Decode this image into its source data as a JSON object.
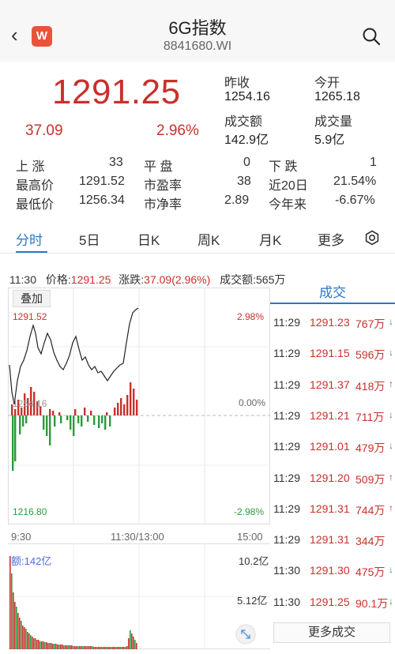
{
  "header": {
    "title": "6G指数",
    "code": "8841680.WI",
    "logo_letter": "W"
  },
  "quote": {
    "price": "1291.25",
    "change": "37.09",
    "change_pct": "2.96%",
    "prev_close_label": "昨收",
    "prev_close": "1254.16",
    "open_label": "今开",
    "open": "1265.18",
    "turnover_label": "成交额",
    "turnover": "142.9亿",
    "volume_label": "成交量",
    "volume": "5.9亿"
  },
  "stats": [
    {
      "l1": "上 涨",
      "v1": "33",
      "l2": "平 盘",
      "v2": "0",
      "l3": "下 跌",
      "v3": "1"
    },
    {
      "l1": "最高价",
      "v1": "1291.52",
      "l2": "市盈率",
      "v2": "38",
      "l3": "近20日",
      "v3": "21.54%"
    },
    {
      "l1": "最低价",
      "v1": "1256.34",
      "l2": "市净率",
      "v2": "2.89",
      "l3": "今年来",
      "v3": "-6.67%"
    }
  ],
  "tabs": [
    "分时",
    "5日",
    "日K",
    "周K",
    "月K",
    "更多"
  ],
  "info": {
    "time": "11:30",
    "price_label": "价格:",
    "price": "1291.25",
    "chg_label": "涨跌:",
    "chg": "37.09(2.96%)",
    "amt_label": "成交额:",
    "amt": "565万"
  },
  "chart": {
    "overlay_label": "叠加",
    "max_price": "1291.52",
    "min_price": "1216.80",
    "mid_price": "1254.16",
    "max_pct": "2.98%",
    "zero_pct": "0.00%",
    "min_pct": "-2.98%",
    "time_start": "9:30",
    "time_mid": "11:30/13:00",
    "time_end": "15:00",
    "vol_label": "额:142亿",
    "vol_max": "10.2亿",
    "vol_mid": "5.12亿"
  },
  "trades": {
    "header": "成交",
    "more": "更多成交",
    "rows": [
      {
        "time": "11:29",
        "price": "1291.23",
        "vol": "767万",
        "dir": "down"
      },
      {
        "time": "11:29",
        "price": "1291.15",
        "vol": "596万",
        "dir": "down"
      },
      {
        "time": "11:29",
        "price": "1291.37",
        "vol": "418万",
        "dir": "up"
      },
      {
        "time": "11:29",
        "price": "1291.21",
        "vol": "711万",
        "dir": "down"
      },
      {
        "time": "11:29",
        "price": "1291.01",
        "vol": "479万",
        "dir": "down"
      },
      {
        "time": "11:29",
        "price": "1291.20",
        "vol": "509万",
        "dir": "up"
      },
      {
        "time": "11:29",
        "price": "1291.31",
        "vol": "744万",
        "dir": "up"
      },
      {
        "time": "11:29",
        "price": "1291.31",
        "vol": "344万",
        "dir": ""
      },
      {
        "time": "11:30",
        "price": "1291.30",
        "vol": "475万",
        "dir": "down"
      },
      {
        "time": "11:30",
        "price": "1291.25",
        "vol": "90.1万",
        "dir": "down"
      }
    ]
  },
  "colors": {
    "up": "#c8312c",
    "down": "#2e9a3e",
    "accent": "#2b78c5"
  },
  "icons": {
    "back": "chevron-left-icon",
    "search": "search-icon",
    "settings": "gear-icon",
    "expand": "expand-icon"
  }
}
